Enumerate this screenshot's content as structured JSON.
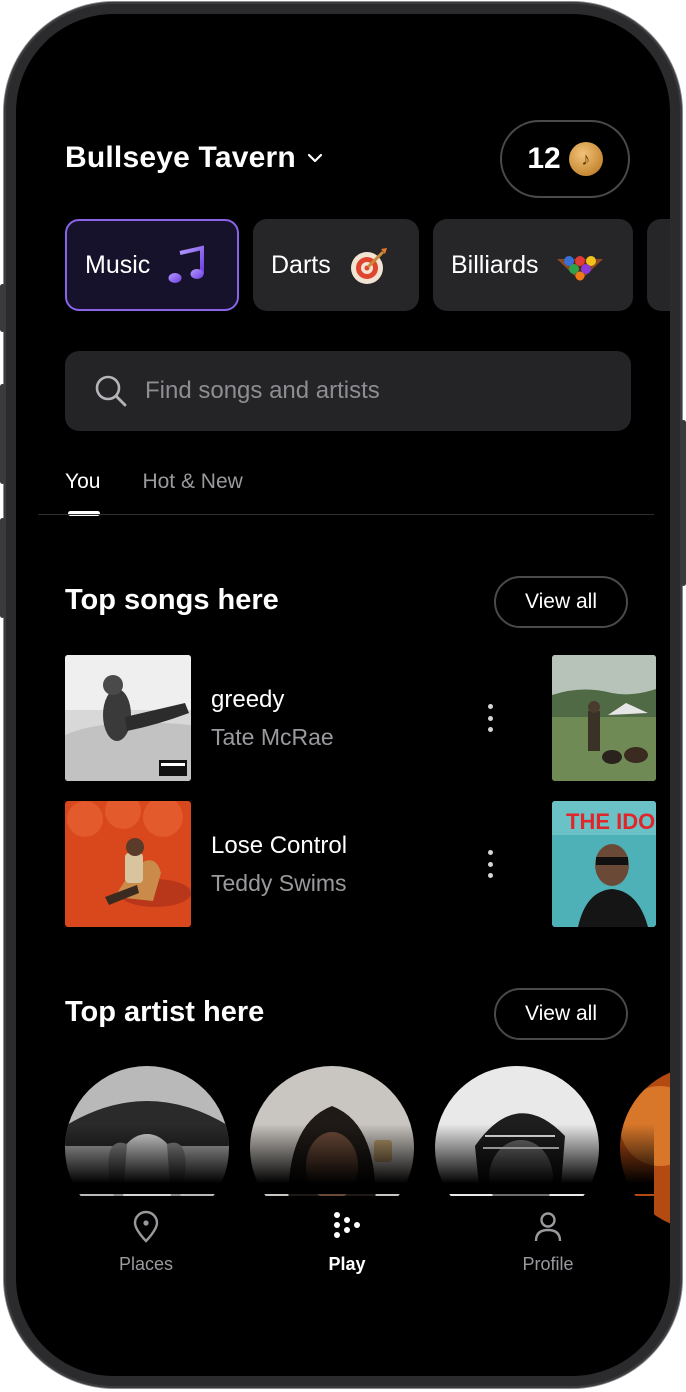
{
  "header": {
    "venue_name": "Bullseye Tavern",
    "credits": "12"
  },
  "categories": [
    {
      "label": "Music",
      "icon": "music-note-icon",
      "active": true
    },
    {
      "label": "Darts",
      "icon": "dartboard-icon"
    },
    {
      "label": "Billiards",
      "icon": "billiards-icon"
    }
  ],
  "search": {
    "placeholder": "Find songs and artists"
  },
  "tabs": [
    {
      "label": "You",
      "active": true
    },
    {
      "label": "Hot & New"
    }
  ],
  "top_songs": {
    "title": "Top songs here",
    "view_all": "View all",
    "items": [
      {
        "title": "greedy",
        "artist": "Tate McRae"
      },
      {
        "title": "Lose Control",
        "artist": "Teddy Swims"
      }
    ],
    "peek_cover_text": "THE IDO"
  },
  "top_artists": {
    "title": "Top artist here",
    "view_all": "View all"
  },
  "nav": [
    {
      "label": "Places",
      "icon": "location-pin-icon"
    },
    {
      "label": "Play",
      "icon": "dots-grid-icon",
      "active": true
    },
    {
      "label": "Profile",
      "icon": "person-icon"
    }
  ],
  "colors": {
    "accent": "#8a63e8",
    "background": "#000000",
    "surface": "#262628"
  }
}
